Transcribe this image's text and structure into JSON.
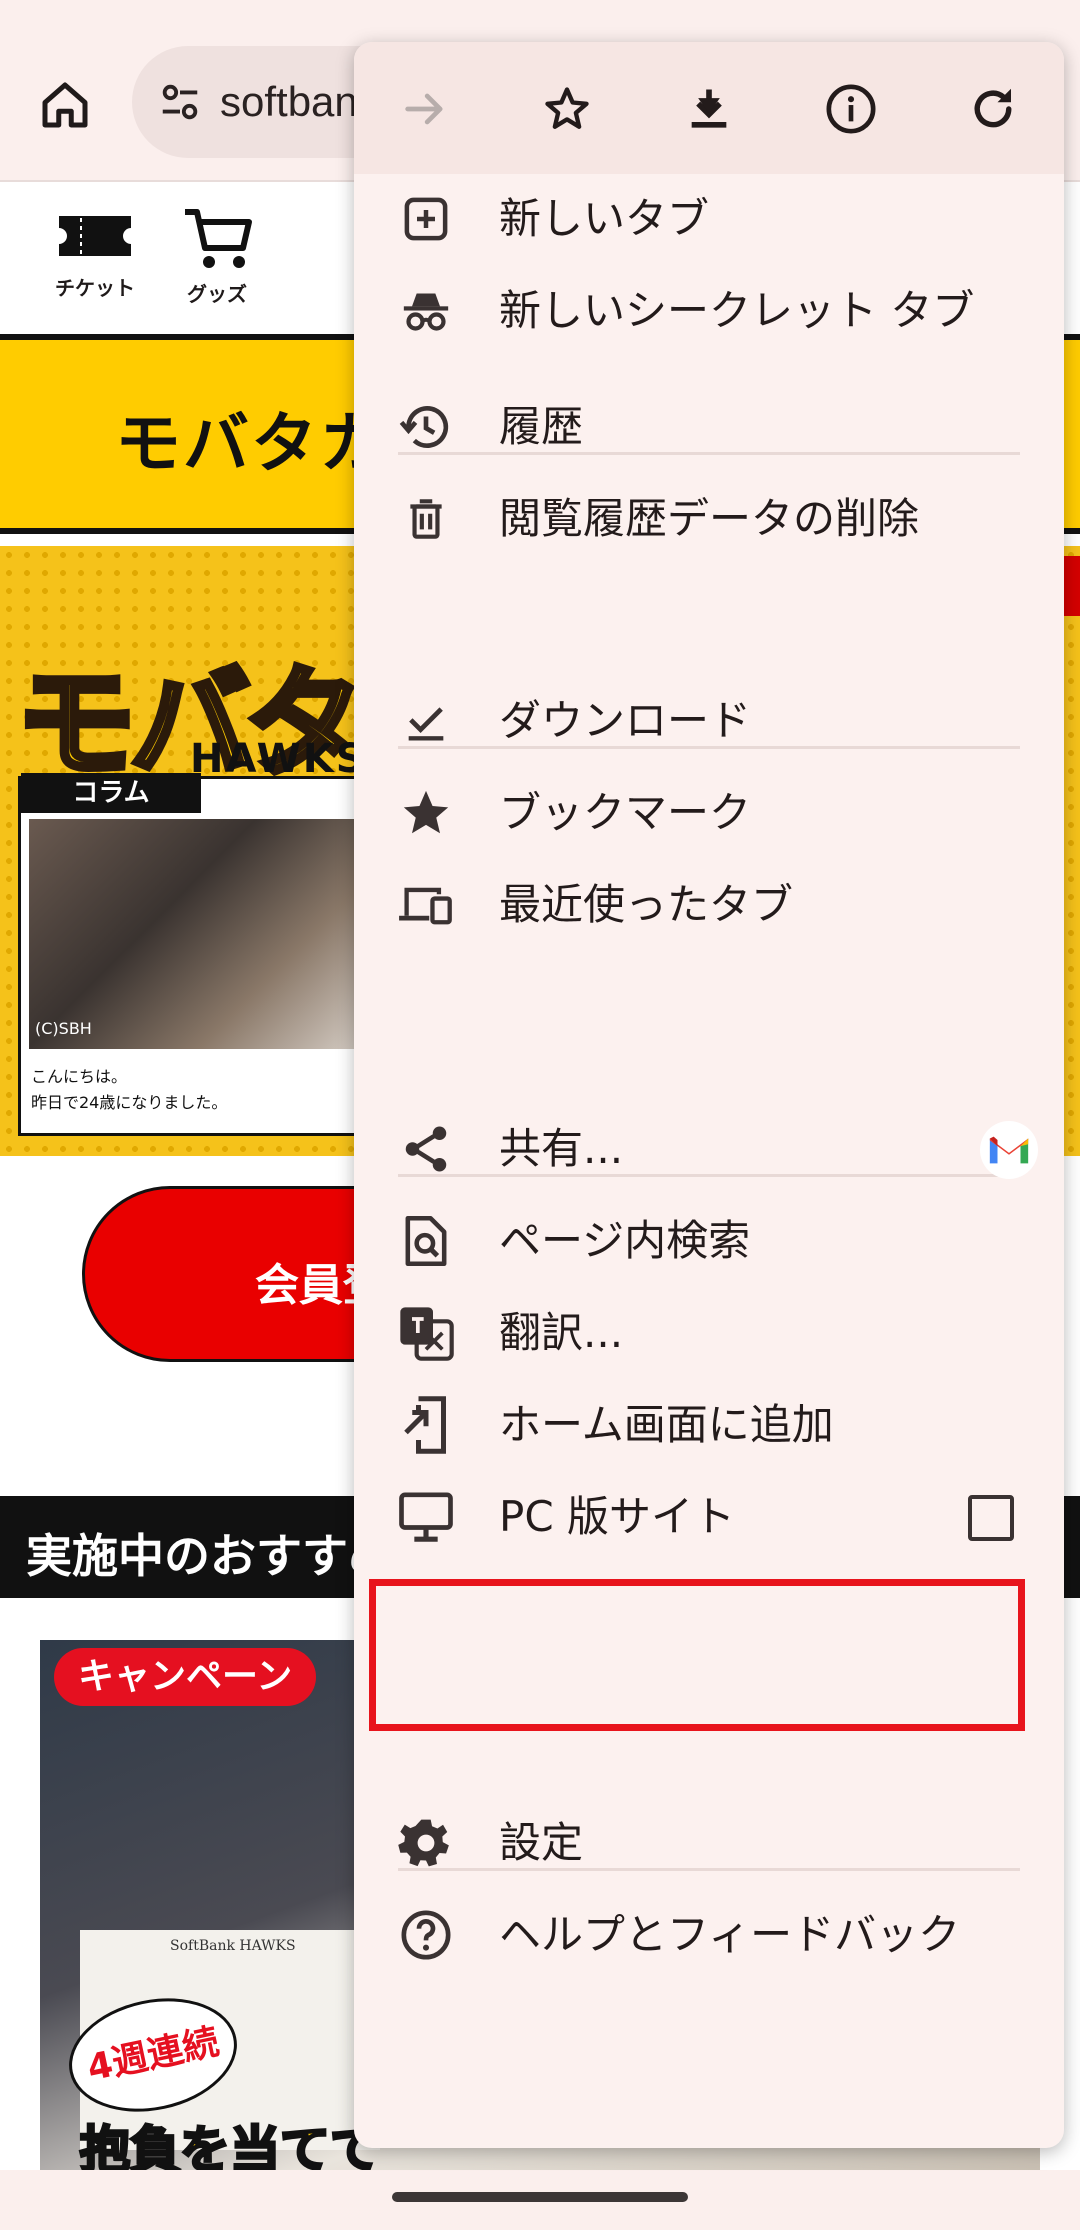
{
  "browser": {
    "url_text": "softbank",
    "colors": {
      "toolbar_bg": "#fbefed",
      "omnibox_bg": "#efe1df",
      "menu_bg": "#fcf1ef",
      "highlight": "#e8141c"
    }
  },
  "page": {
    "quick_links": [
      {
        "label": "チケット",
        "icon": "ticket-icon"
      },
      {
        "label": "グッズ",
        "icon": "cart-icon"
      }
    ],
    "banner_text": "モバタカ",
    "promo": {
      "logo_text": "モバタカ",
      "logo_sub": "HAWKS",
      "card_tag": "コラム",
      "photo_credit": "(C)SBH",
      "caption_line1": "こんにちは。",
      "caption_line2": "昨日で24歳になりました。"
    },
    "signup_button": "会員登録",
    "section_title": "実施中のおすすめ",
    "campaign": {
      "pill": "キャンペーン",
      "board_text": "SoftBank HAWKS",
      "weekly_badge": "4週連続",
      "catch_text": "抱負を当てて"
    }
  },
  "menu": {
    "toolbar_icons": [
      "forward-icon",
      "star-icon",
      "download-icon",
      "info-icon",
      "reload-icon"
    ],
    "items": [
      {
        "label": "新しいタブ",
        "icon": "new-tab-icon"
      },
      {
        "label": "新しいシークレット タブ",
        "icon": "incognito-icon"
      },
      {
        "label": "履歴",
        "icon": "history-icon"
      },
      {
        "label": "閲覧履歴データの削除",
        "icon": "trash-icon"
      },
      {
        "label": "ダウンロード",
        "icon": "downloads-icon"
      },
      {
        "label": "ブックマーク",
        "icon": "bookmark-star-icon"
      },
      {
        "label": "最近使ったタブ",
        "icon": "devices-icon"
      },
      {
        "label": "共有...",
        "icon": "share-icon"
      },
      {
        "label": "ページ内検索",
        "icon": "find-in-page-icon"
      },
      {
        "label": "翻訳...",
        "icon": "translate-icon"
      },
      {
        "label": "ホーム画面に追加",
        "icon": "add-to-home-icon"
      },
      {
        "label": "PC 版サイト",
        "icon": "desktop-icon"
      },
      {
        "label": "設定",
        "icon": "settings-gear-icon"
      },
      {
        "label": "ヘルプとフィードバック",
        "icon": "help-icon"
      }
    ],
    "desktop_site_checked": false
  }
}
